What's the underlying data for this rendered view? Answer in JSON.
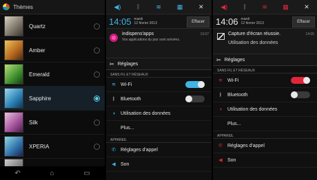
{
  "themes_panel": {
    "title": "Thèmes",
    "items": [
      {
        "label": "Quartz",
        "selected": false
      },
      {
        "label": "Amber",
        "selected": false
      },
      {
        "label": "Emerald",
        "selected": false
      },
      {
        "label": "Sapphire",
        "selected": true
      },
      {
        "label": "Silk",
        "selected": false
      },
      {
        "label": "XPERIA",
        "selected": false
      }
    ],
    "nav_icons": [
      "back-icon",
      "home-icon",
      "recent-apps-icon"
    ]
  },
  "shade_blue": {
    "accent": "#3fb4e6",
    "time": "14:05",
    "date_line1": "mardi",
    "date_line2": "12 février 2013",
    "clear_label": "Effacer",
    "notification": {
      "title": "indispens'apps",
      "subtitle": "Vos applications du jour sont arrivées.",
      "time": "13:07"
    },
    "settings_header": "Réglages",
    "section_wireless": "SANS FIL ET RÉSEAUX",
    "wifi_label": "Wi-Fi",
    "bluetooth_label": "Bluetooth",
    "data_label": "Utilisation des données",
    "more_label": "Plus...",
    "section_device": "APPAREIL",
    "call_label": "Réglages d'appel",
    "sound_label": "Son"
  },
  "shade_red": {
    "accent": "#e0263a",
    "time": "14:06",
    "date_line1": "mardi",
    "date_line2": "12 février 2013",
    "clear_label": "Effacer",
    "notification": {
      "title": "Capture d'écran réussie.",
      "time": "14:05"
    },
    "data_overlap_label": "Utilisation des données",
    "settings_header": "Réglages",
    "section_wireless": "SANS FIL ET RÉSEAUX",
    "wifi_label": "Wi-Fi",
    "bluetooth_label": "Bluetooth",
    "data_label": "Utilisation des données",
    "more_label": "Plus...",
    "section_device": "APPAREIL",
    "call_label": "Réglages d'appel",
    "sound_label": "Son"
  }
}
